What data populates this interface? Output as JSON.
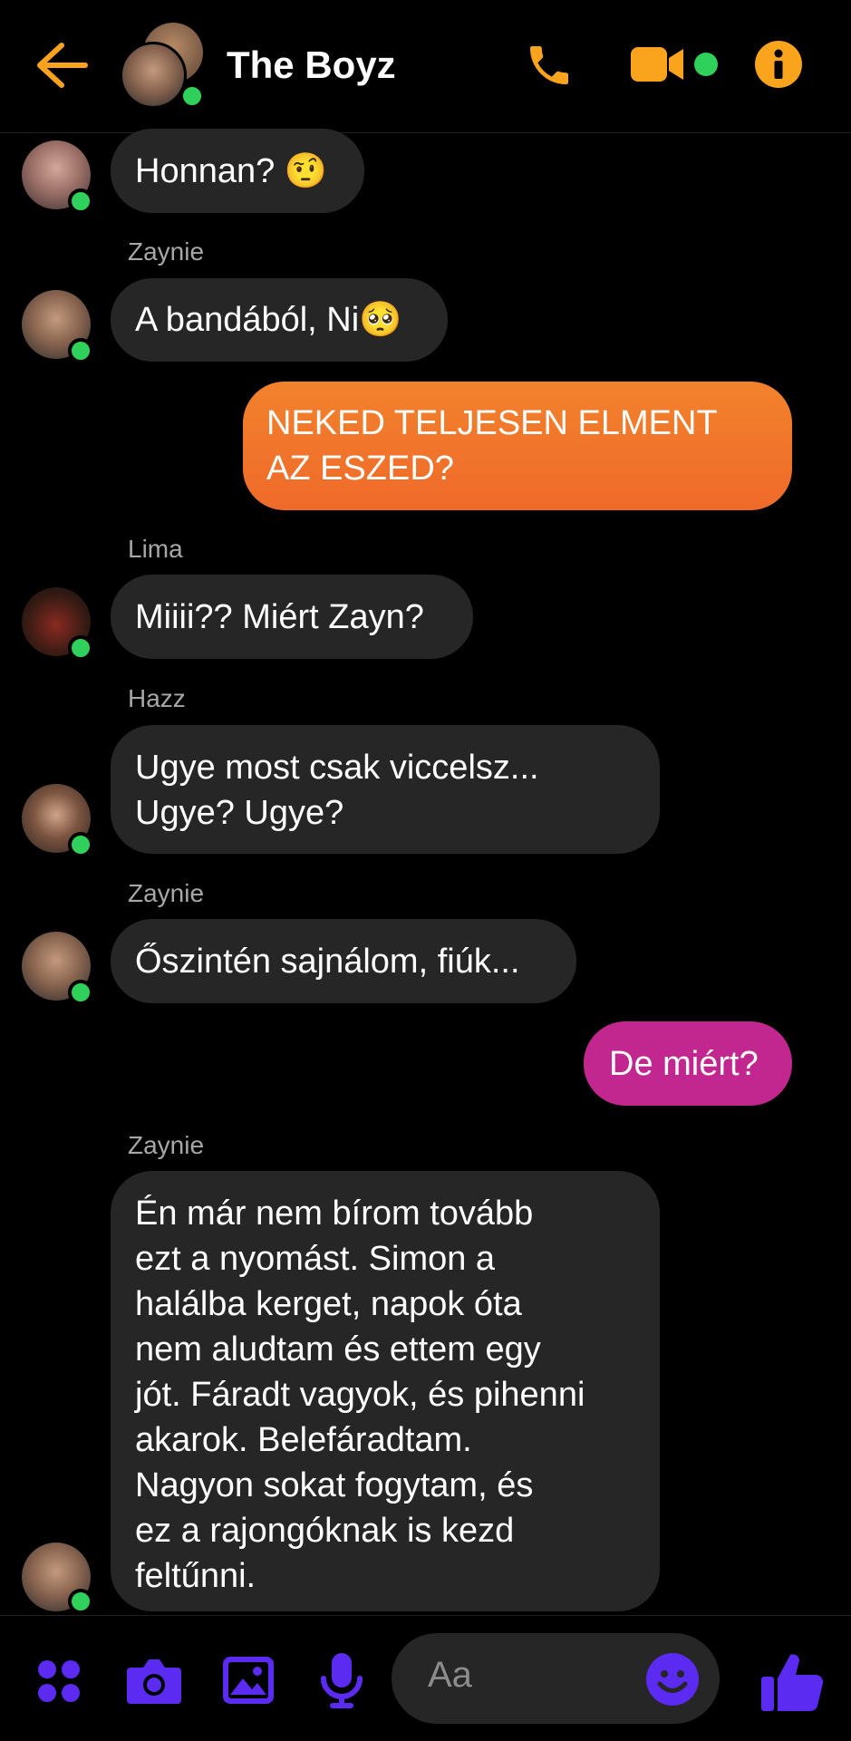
{
  "header": {
    "title": "The Boyz",
    "back_icon": "arrow-left-icon",
    "call_icon": "phone-icon",
    "video_icon": "video-camera-icon",
    "info_icon": "info-icon",
    "accent_color": "#f9a41c",
    "online_color": "#2fd15a"
  },
  "messages": [
    {
      "sender": "",
      "text": "Honnan? 🤨",
      "from_me": false
    },
    {
      "sender": "Zaynie",
      "text": "A bandából, Ni🥺",
      "from_me": false
    },
    {
      "sender": "",
      "text": "NEKED TELJESEN ELMENT\nAZ ESZED?",
      "from_me": true
    },
    {
      "sender": "Lima",
      "text": "Miiii?? Miért Zayn?",
      "from_me": false
    },
    {
      "sender": "Hazz",
      "text": "Ugye most csak viccelsz...\nUgye? Ugye?",
      "from_me": false
    },
    {
      "sender": "Zaynie",
      "text": "Őszintén sajnálom, fiúk...",
      "from_me": false
    },
    {
      "sender": "",
      "text": "De miért?",
      "from_me": true
    },
    {
      "sender": "Zaynie",
      "text": "Én már nem bírom tovább\nezt a nyomást. Simon a\nhalálba kerget, napok óta\nnem aludtam és ettem egy\njót. Fáradt vagyok, és pihenni\nakarok. Belefáradtam.\nNagyon sokat fogytam, és\nez a rajongóknak is kezd\nfeltűnni.",
      "from_me": false
    }
  ],
  "composer": {
    "placeholder": "Aa",
    "icons": [
      "apps-icon",
      "camera-icon",
      "image-icon",
      "microphone-icon",
      "emoji-icon",
      "thumbs-up-icon"
    ],
    "icon_color": "#5b2bf2"
  }
}
